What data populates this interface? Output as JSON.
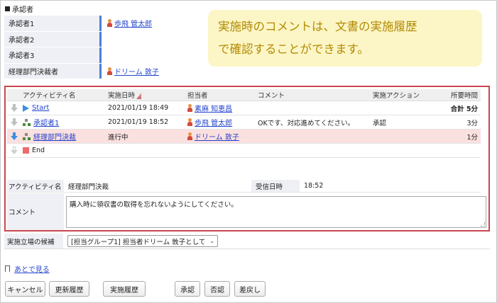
{
  "section_title": "承認者",
  "approvers": [
    {
      "label": "承認者1",
      "value": "歩飛 管太郎",
      "has_person": true
    },
    {
      "label": "承認者2",
      "value": "",
      "has_person": false
    },
    {
      "label": "承認者3",
      "value": "",
      "has_person": false
    },
    {
      "label": "経理部門決裁者",
      "value": "ドリーム 敦子",
      "has_person": true
    }
  ],
  "callout": {
    "line1": "実施時のコメントは、文書の実施履歴",
    "line2": "で確認することができます。"
  },
  "activity_table": {
    "headers": {
      "activity": "アクティビティ名",
      "date": "実施日時",
      "person": "担当者",
      "comment": "コメント",
      "action": "実施アクション",
      "time": "所要時間"
    },
    "rows": [
      {
        "arrow": "gray",
        "icon": "play",
        "name": "Start",
        "date": "2021/01/19 18:49",
        "person": "素麻 知恵昌",
        "comment": "",
        "action": "",
        "time": "合計 5分"
      },
      {
        "arrow": "gray",
        "icon": "flow",
        "name": "承認者1",
        "date": "2021/01/19 18:52",
        "person": "歩飛 管太郎",
        "comment": "OKです、対応進めてください。",
        "action": "承認",
        "time": "3分"
      },
      {
        "arrow": "blue",
        "icon": "flow",
        "name": "経理部門決裁",
        "date": "進行中",
        "person": "ドリーム 敦子",
        "comment": "",
        "action": "",
        "time": "1分"
      },
      {
        "arrow": "outline",
        "icon": "stop",
        "name": "End",
        "date": "",
        "person": "",
        "comment": "",
        "action": "",
        "time": ""
      }
    ]
  },
  "detail": {
    "activity_label": "アクティビティ名",
    "activity_value": "経理部門決裁",
    "received_label": "受信日時",
    "received_value": "18:52",
    "comment_label": "コメント",
    "comment_value": "購入時に領収書の取得を忘れないようにしてください。"
  },
  "role": {
    "label": "実施立場の候補",
    "selected": "[担当グループ1] 担当者ドリーム 敦子として"
  },
  "later_link": "あとで見る",
  "buttons": {
    "cancel": "キャンセル",
    "update_history": "更新履歴",
    "exec_history": "実施履歴",
    "approve": "承認",
    "reject": "否認",
    "send_back": "差戻し"
  },
  "colors": {
    "highlight_border": "#c8474f",
    "callout_bg": "#fcf6c6",
    "callout_text": "#b28a05",
    "link": "#2244cc",
    "current_row_bg": "#fbe0e0"
  }
}
